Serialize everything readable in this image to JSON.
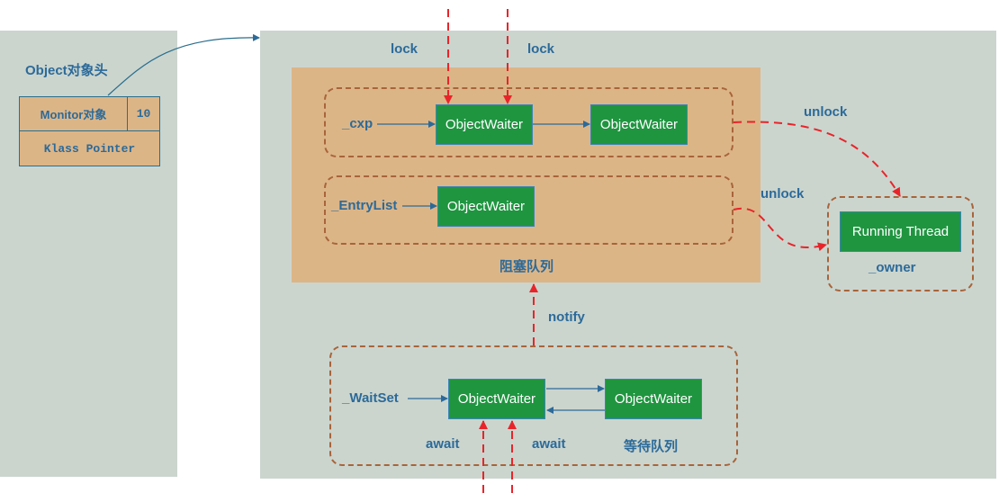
{
  "object_header": {
    "title": "Object对象头",
    "monitor_cell": "Monitor对象",
    "flag_cell": "10",
    "klass_cell": "Klass Pointer"
  },
  "monitor": {
    "lock_labels": [
      "lock",
      "lock"
    ],
    "cxq": {
      "label": "_cxp",
      "nodes": [
        "ObjectWaiter",
        "ObjectWaiter"
      ]
    },
    "entry_list": {
      "label": "_EntryList",
      "nodes": [
        "ObjectWaiter"
      ]
    },
    "blocking_queue_label": "阻塞队列",
    "unlock_labels": [
      "unlock",
      "unlock"
    ],
    "owner": {
      "node": "Running Thread",
      "label": "_owner"
    },
    "notify_label": "notify",
    "wait_set": {
      "label": "_WaitSet",
      "nodes": [
        "ObjectWaiter",
        "ObjectWaiter"
      ]
    },
    "await_labels": [
      "await",
      "await"
    ],
    "waiting_queue_label": "等待队列"
  },
  "colors": {
    "panel": "#cbd5ce",
    "queue_bg": "#dcb587",
    "node": "#1f9540",
    "label": "#2c6a99",
    "dash_border": "#a8643a",
    "signal_arrow": "#e8242a"
  }
}
